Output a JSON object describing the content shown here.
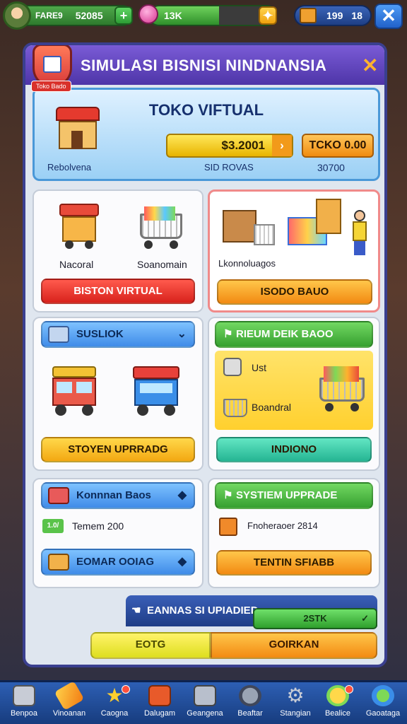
{
  "topbar": {
    "resource1_label": "FARE9",
    "resource1_value": "52085",
    "resource2_value": "13K",
    "resource2_fill": 0.55,
    "resource3_value": "199",
    "resource3_secondary": "18",
    "plus_symbol": "+",
    "close_symbol": "✕"
  },
  "panel": {
    "title": "SIMULASI BISNISI NINDNANSIA",
    "close_symbol": "✕",
    "shield_tag": "Toko Bado"
  },
  "store": {
    "title": "TOKO VIFTUAL",
    "money": "$3.2001",
    "toko_button": "TCKO 0.00",
    "caption": "Rebolvena",
    "rounds": "SID ROVAS",
    "value": "30700"
  },
  "card1": {
    "label_left": "Nacoral",
    "label_right": "Soanomain",
    "button": "BISTON VIRTUAL"
  },
  "card2": {
    "label": "Lkonnoluagos",
    "button": "ISODO BAUO"
  },
  "card3": {
    "header": "SUSLIOK",
    "button": "STOYEN UPRRADG"
  },
  "card4": {
    "header": "RIEUM DEIK BAOO",
    "label_top": "Ust",
    "label_bottom": "Boandral",
    "button": "INDIONO"
  },
  "card5": {
    "header": "Konnnan Baos",
    "stat_badge": "1.0/",
    "stat_text": "Temem 200",
    "button": "EOMAR OOIAG"
  },
  "card6": {
    "header": "SYSTIEM UPPRADE",
    "stat_text": "Fnoheraoer 2814",
    "button": "TENTIN SFIABB"
  },
  "footer": {
    "upgrade_label": "EANNAS SI UPIADIED",
    "green_value": "2STK",
    "yellow_button": "EOTG",
    "orange_button": "GOIRKAN"
  },
  "bottom_nav": [
    {
      "label": "Benpoa",
      "icon": "box-icon",
      "badge": false
    },
    {
      "label": "Vinoanan",
      "icon": "pencil-icon",
      "badge": false
    },
    {
      "label": "Caogna",
      "icon": "star-icon",
      "badge": true
    },
    {
      "label": "Dalugam",
      "icon": "calculator-icon",
      "badge": false
    },
    {
      "label": "Geangena",
      "icon": "register-icon",
      "badge": false
    },
    {
      "label": "Beaftar",
      "icon": "tools-icon",
      "badge": false
    },
    {
      "label": "Stangian",
      "icon": "gear-icon",
      "badge": false
    },
    {
      "label": "Bealice",
      "icon": "trophy-icon",
      "badge": true
    },
    {
      "label": "Gaoataga",
      "icon": "globe-icon",
      "badge": false
    }
  ],
  "colors": {
    "panel_border": "#3a3f8f",
    "header_purple": "#6a4bc8",
    "accent_orange": "#f28a12",
    "accent_green": "#36a030",
    "accent_red": "#d8221c"
  }
}
